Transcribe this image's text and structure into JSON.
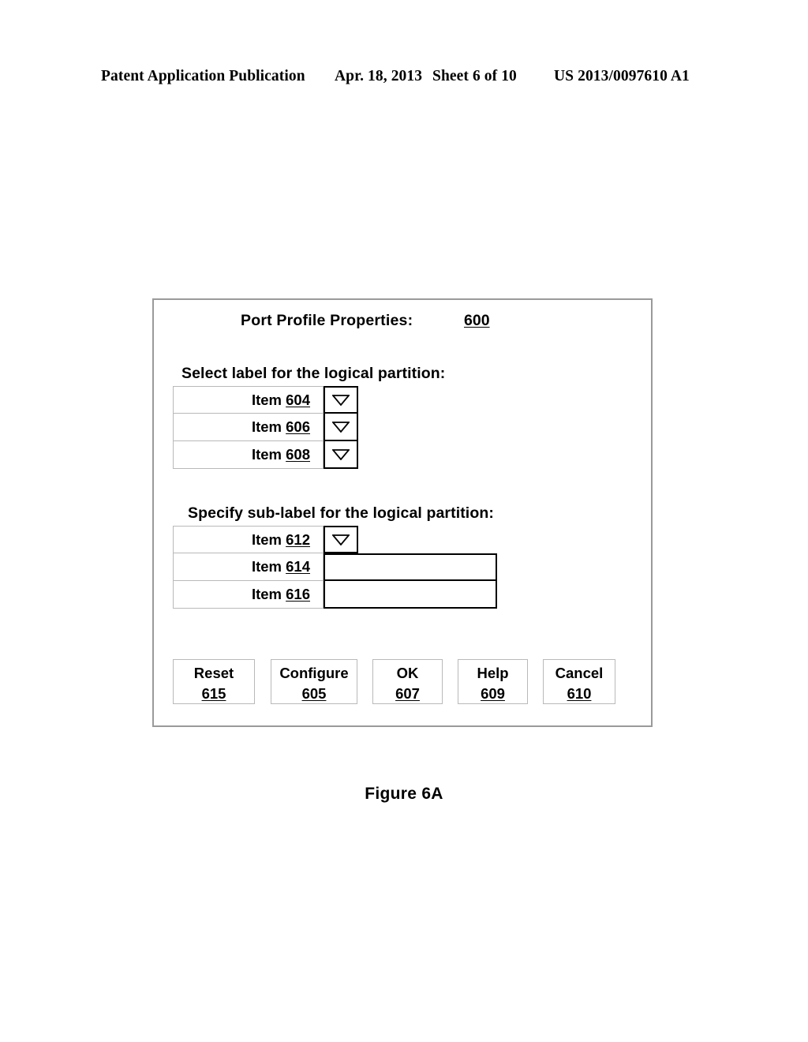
{
  "page_header": {
    "publication": "Patent Application Publication",
    "date": "Apr. 18, 2013",
    "sheet": "Sheet 6 of 10",
    "patent_number": "US 2013/0097610 A1"
  },
  "dialog": {
    "title": "Port Profile Properties:",
    "title_ref": "600",
    "sections": [
      {
        "heading": "Select label for the logical partition:",
        "rows": [
          {
            "label": "Item ",
            "ref": "604",
            "control": "dropdown"
          },
          {
            "label": "Item ",
            "ref": "606",
            "control": "dropdown"
          },
          {
            "label": "Item ",
            "ref": "608",
            "control": "dropdown"
          }
        ]
      },
      {
        "heading": "Specify sub-label for the logical partition:",
        "rows": [
          {
            "label": "Item ",
            "ref": "612",
            "control": "dropdown"
          },
          {
            "label": "Item ",
            "ref": "614",
            "control": "textbox"
          },
          {
            "label": "Item ",
            "ref": "616",
            "control": "textbox"
          }
        ]
      }
    ],
    "buttons": [
      {
        "label": "Reset",
        "ref": "615"
      },
      {
        "label": "Configure",
        "ref": "605"
      },
      {
        "label": "OK",
        "ref": "607"
      },
      {
        "label": "Help",
        "ref": "609"
      },
      {
        "label": "Cancel",
        "ref": "610"
      }
    ]
  },
  "figure_caption": "Figure 6A",
  "colors": {
    "ink": "#000000",
    "light_rule": "#b9b9b9",
    "frame": "#9a9a9a",
    "page": "#ffffff"
  },
  "icons": {
    "dropdown": "triangle-down-icon"
  }
}
